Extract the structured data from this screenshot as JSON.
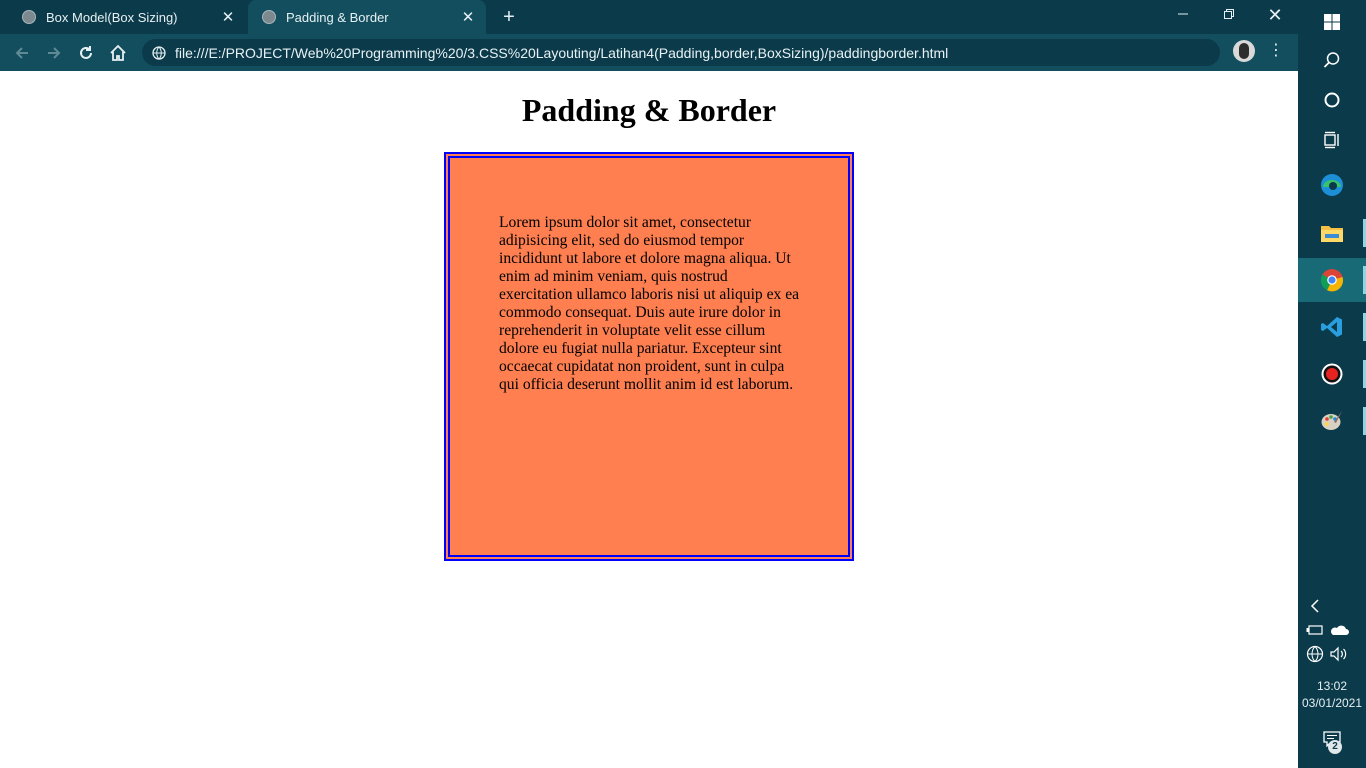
{
  "browser": {
    "tabs": [
      {
        "title": "Box Model(Box Sizing)",
        "active": false
      },
      {
        "title": "Padding & Border",
        "active": true
      }
    ],
    "url": "file:///E:/PROJECT/Web%20Programming%20/3.CSS%20Layouting/Latihan4(Padding,border,BoxSizing)/paddingborder.html"
  },
  "page": {
    "heading": "Padding & Border",
    "paragraph": "Lorem ipsum dolor sit amet, consectetur adipisicing elit, sed do eiusmod tempor incididunt ut labore et dolore magna aliqua. Ut enim ad minim veniam, quis nostrud exercitation ullamco laboris nisi ut aliquip ex ea commodo consequat. Duis aute irure dolor in reprehenderit in voluptate velit esse cillum dolore eu fugiat nulla pariatur. Excepteur sint occaecat cupidatat non proident, sunt in culpa qui officia deserunt mollit anim id est laborum.",
    "box_background": "#ff7f50",
    "box_border": "#0000ff"
  },
  "taskbar": {
    "apps": [
      "windows-start",
      "search",
      "cortana",
      "task-view",
      "edge",
      "file-explorer",
      "chrome",
      "vscode",
      "screen-recorder",
      "paint"
    ],
    "time": "13:02",
    "date": "03/01/2021",
    "notification_count": "2"
  }
}
